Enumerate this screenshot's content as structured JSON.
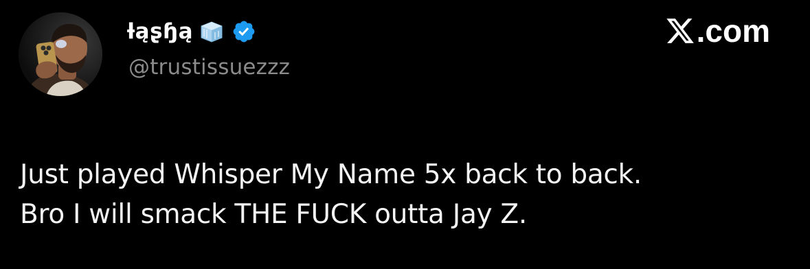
{
  "author": {
    "display_name": "ƚąʂɧą",
    "handle": "@trustissuezzz",
    "name_emoji_icon": "ice-cube-icon",
    "verified_icon": "verified-badge-icon",
    "verified_color": "#1d9bf0"
  },
  "branding": {
    "logo_icon": "x-logo-icon",
    "site_suffix": ".com"
  },
  "tweet": {
    "lines": [
      "Just played Whisper My Name 5x back to back.",
      "Bro I will smack THE FUCK outta Jay Z."
    ]
  },
  "colors": {
    "background": "#000000",
    "text": "#f4f4f4",
    "handle": "#8b8b8b"
  }
}
